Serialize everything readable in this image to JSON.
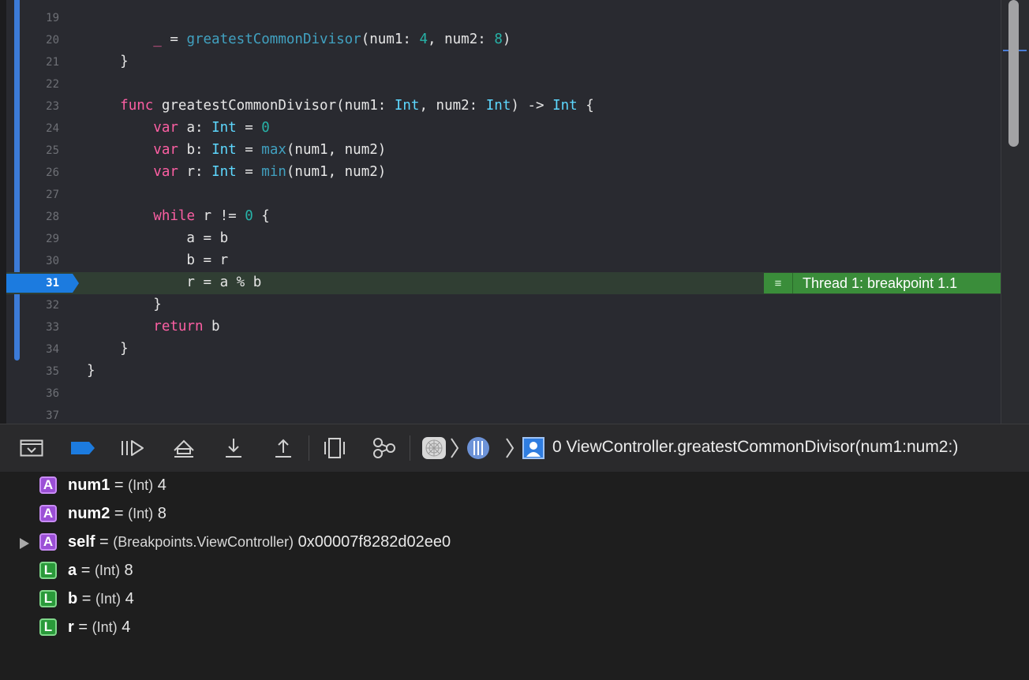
{
  "editor": {
    "lines": [
      {
        "num": "19",
        "code": ""
      },
      {
        "num": "20",
        "code": "        _ = greatestCommonDivisor(num1: 4, num2: 8)"
      },
      {
        "num": "21",
        "code": "    }"
      },
      {
        "num": "22",
        "code": ""
      },
      {
        "num": "23",
        "code": "    func greatestCommonDivisor(num1: Int, num2: Int) -> Int {"
      },
      {
        "num": "24",
        "code": "        var a: Int = 0"
      },
      {
        "num": "25",
        "code": "        var b: Int = max(num1, num2)"
      },
      {
        "num": "26",
        "code": "        var r: Int = min(num1, num2)"
      },
      {
        "num": "27",
        "code": ""
      },
      {
        "num": "28",
        "code": "        while r != 0 {"
      },
      {
        "num": "29",
        "code": "            a = b"
      },
      {
        "num": "30",
        "code": "            b = r"
      },
      {
        "num": "31",
        "code": "            r = a % b"
      },
      {
        "num": "32",
        "code": "        }"
      },
      {
        "num": "33",
        "code": "        return b"
      },
      {
        "num": "34",
        "code": "    }"
      },
      {
        "num": "35",
        "code": "}"
      },
      {
        "num": "36",
        "code": ""
      },
      {
        "num": "37",
        "code": ""
      }
    ],
    "current_line": "31",
    "thread_badge": "Thread 1: breakpoint 1.1"
  },
  "toolbar": {
    "breadcrumb_frame": "0 ViewController.greatestCommonDivisor(num1:num2:)",
    "icons": [
      "hide-debug-area-icon",
      "breakpoints-toggle-icon",
      "continue-icon",
      "step-over-icon",
      "step-into-icon",
      "step-out-icon",
      "view-hierarchy-icon",
      "memory-graph-icon",
      "app-icon",
      "thread-icon",
      "frame-icon"
    ]
  },
  "variables": [
    {
      "kind": "A",
      "name": "num1",
      "eq": "=",
      "type": "(Int)",
      "value": "4",
      "expandable": false
    },
    {
      "kind": "A",
      "name": "num2",
      "eq": "=",
      "type": "(Int)",
      "value": "8",
      "expandable": false
    },
    {
      "kind": "A",
      "name": "self",
      "eq": "=",
      "type": "(Breakpoints.ViewController)",
      "value": "0x00007f8282d02ee0",
      "expandable": true
    },
    {
      "kind": "L",
      "name": "a",
      "eq": "=",
      "type": "(Int)",
      "value": "8",
      "expandable": false
    },
    {
      "kind": "L",
      "name": "b",
      "eq": "=",
      "type": "(Int)",
      "value": "4",
      "expandable": false
    },
    {
      "kind": "L",
      "name": "r",
      "eq": "=",
      "type": "(Int)",
      "value": "4",
      "expandable": false
    }
  ],
  "colors": {
    "editor_bg": "#292a30",
    "keyword": "#fc5fa3",
    "type": "#5dd8ff",
    "function": "#41a1c0",
    "number": "#27b3a8",
    "breakpoint": "#1c7bdf",
    "thread_badge": "#3a8d3a",
    "arg_badge": "#9b4fd6",
    "local_badge": "#2a9a3a"
  }
}
